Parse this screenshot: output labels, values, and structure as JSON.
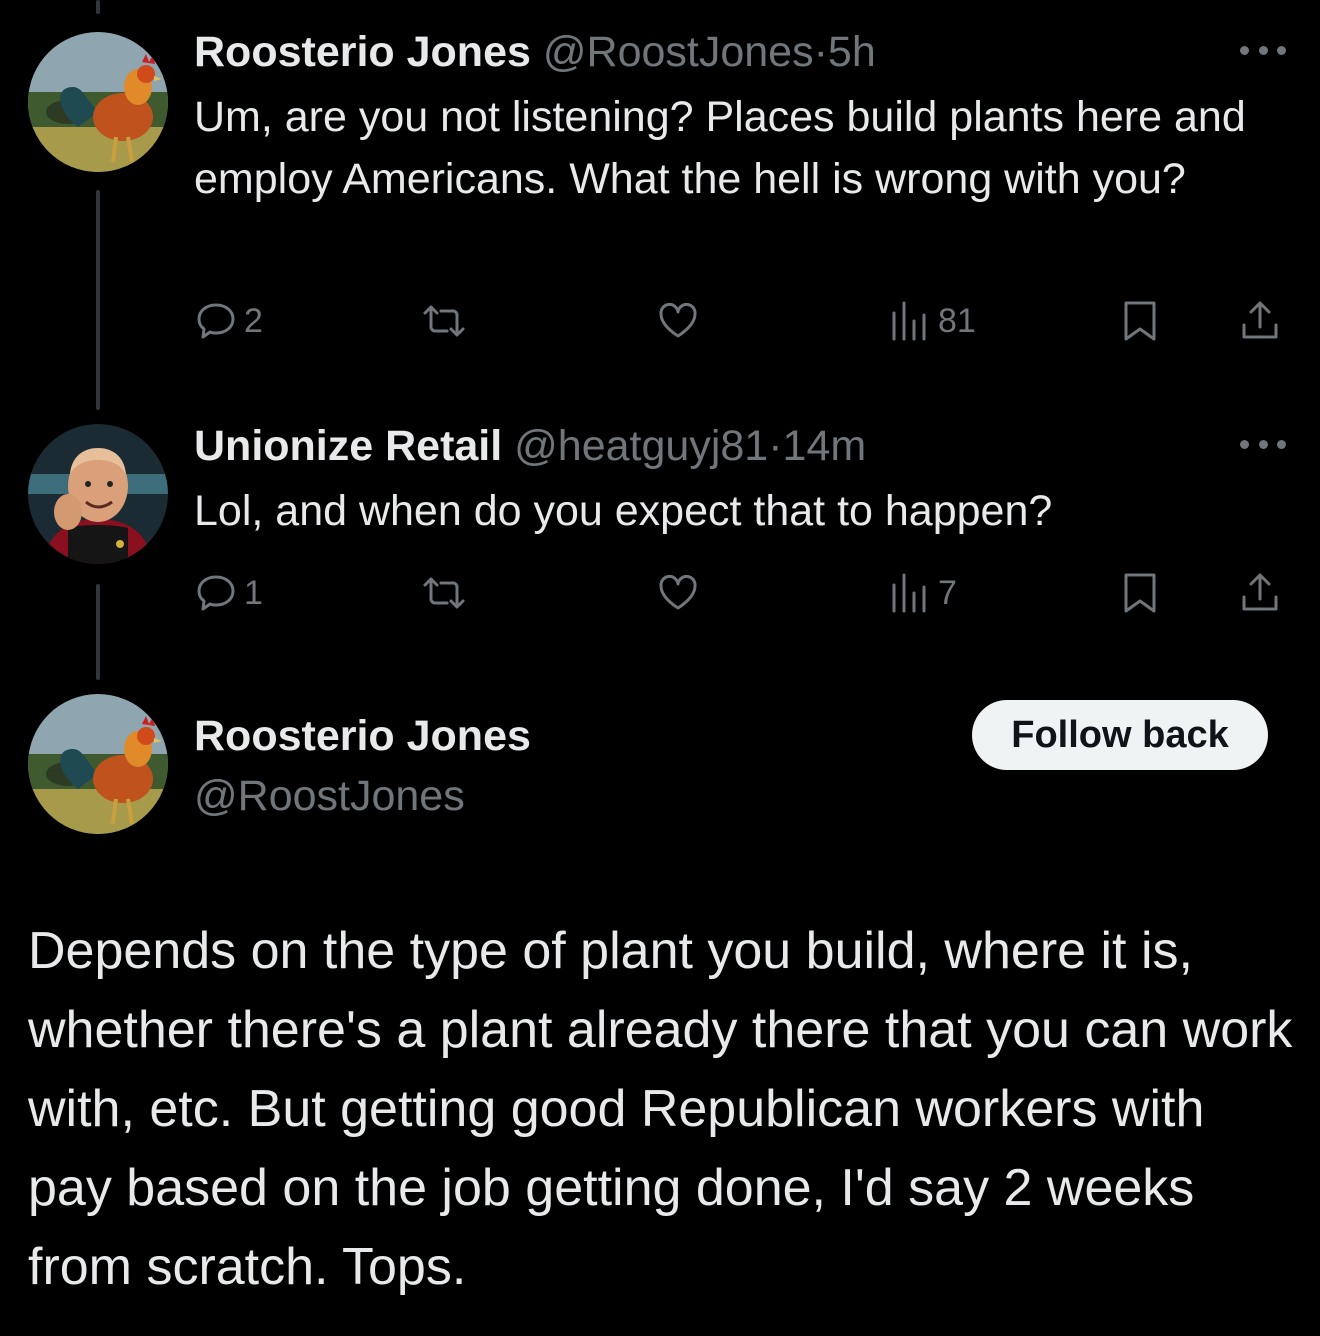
{
  "tweets": [
    {
      "name": "Roosterio Jones",
      "handle": "@RoostJones",
      "dot": "·",
      "time": "5h",
      "text": "Um, are you not listening? Places build plants here and employ Americans. What the hell is wrong with you?",
      "replies": "2",
      "retweets": "",
      "likes": "",
      "views": "81",
      "avatar_icon": "rooster-avatar"
    },
    {
      "name": "Unionize Retail",
      "handle": "@heatguyj81",
      "dot": "·",
      "time": "14m",
      "text": "Lol, and when do you expect that to happen?",
      "replies": "1",
      "retweets": "",
      "likes": "",
      "views": "7",
      "avatar_icon": "picard-avatar"
    }
  ],
  "main_tweet": {
    "name": "Roosterio Jones",
    "handle": "@RoostJones",
    "follow_label": "Follow back",
    "text": "Depends on the type of plant you build, where it is, whether there's a plant already there that you can work with, etc. But getting good Republican workers with pay based on the job getting done, I'd say 2 weeks from scratch. Tops.",
    "avatar_icon": "rooster-avatar"
  },
  "colors": {
    "background": "#000000",
    "text": "#e7e9ea",
    "muted": "#71767b",
    "thread_line": "#333639",
    "button_bg": "#eff3f4"
  }
}
